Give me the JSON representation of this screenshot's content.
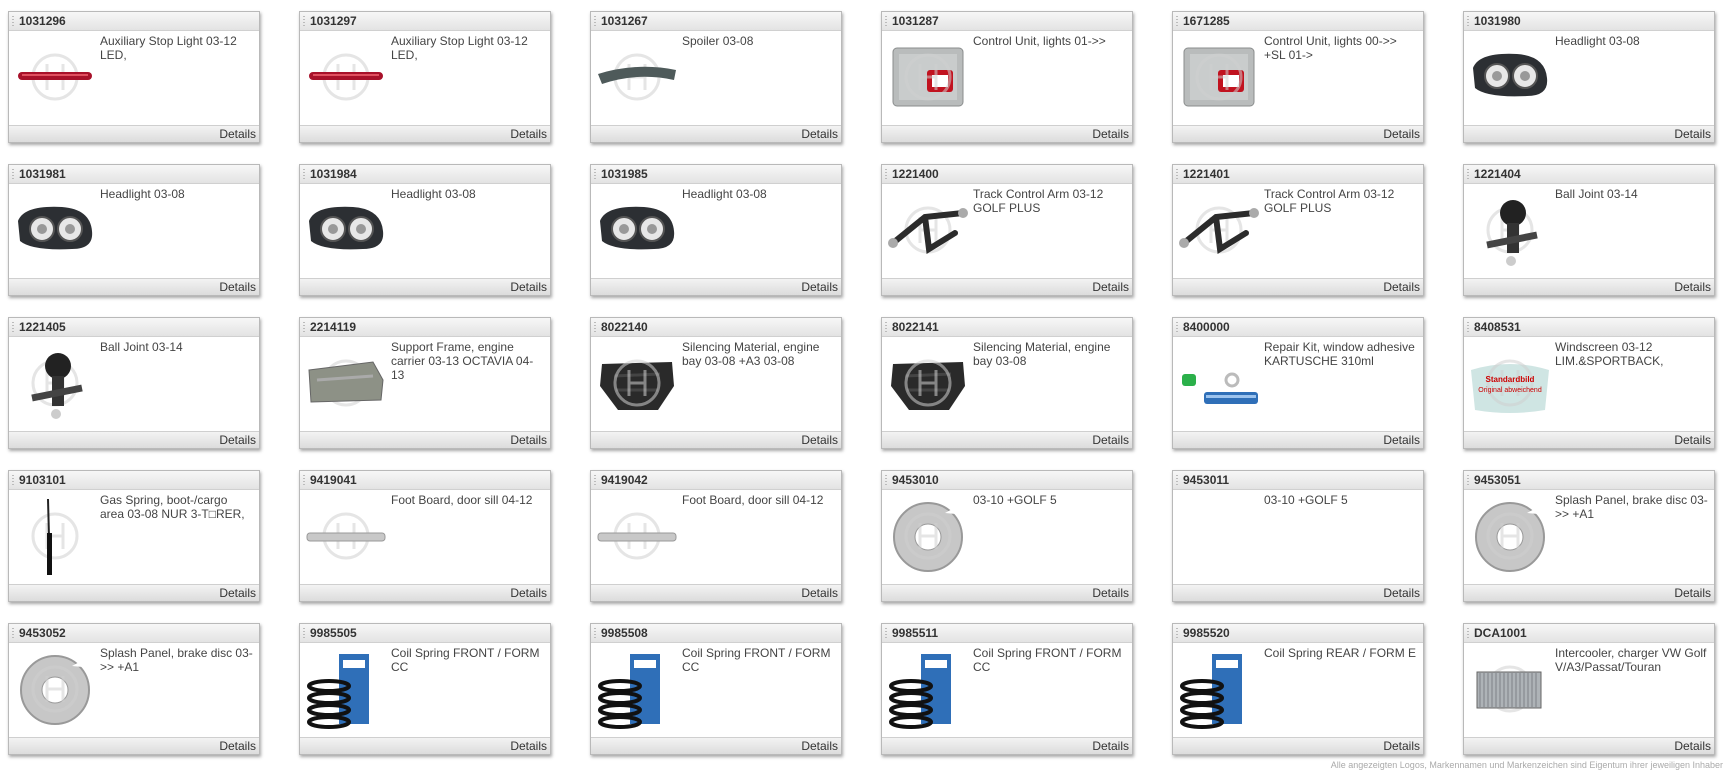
{
  "details_label": "Details",
  "footer_note": "Alle angezeigten Logos, Markennamen und Markenzeichen sind Eigentum ihrer jeweiligen Inhaber",
  "colors": {
    "card_border": "#b9b9b9",
    "header_bg": "#e9e9e9",
    "text": "#444444",
    "watermark": "#d5d5d5",
    "placeholder_red": "#cc0000"
  },
  "products": [
    {
      "id": "1031296",
      "desc": "Auxiliary Stop Light 03-12 LED,",
      "icon": "stop-light-icon"
    },
    {
      "id": "1031297",
      "desc": "Auxiliary Stop Light 03-12 LED,",
      "icon": "stop-light-icon"
    },
    {
      "id": "1031267",
      "desc": "Spoiler 03-08",
      "icon": "spoiler-icon"
    },
    {
      "id": "1031287",
      "desc": "Control Unit, lights 01->>",
      "icon": "control-unit-icon"
    },
    {
      "id": "1671285",
      "desc": "Control Unit, lights 00->> +SL 01->",
      "icon": "control-unit-icon"
    },
    {
      "id": "1031980",
      "desc": "Headlight 03-08",
      "icon": "headlight-icon"
    },
    {
      "id": "1031981",
      "desc": "Headlight 03-08",
      "icon": "headlight-icon"
    },
    {
      "id": "1031984",
      "desc": "Headlight 03-08",
      "icon": "headlight-icon"
    },
    {
      "id": "1031985",
      "desc": "Headlight 03-08",
      "icon": "headlight-icon"
    },
    {
      "id": "1221400",
      "desc": "Track Control Arm 03-12 GOLF PLUS",
      "icon": "control-arm-icon"
    },
    {
      "id": "1221401",
      "desc": "Track Control Arm 03-12 GOLF PLUS",
      "icon": "control-arm-icon"
    },
    {
      "id": "1221404",
      "desc": "Ball Joint 03-14",
      "icon": "ball-joint-icon"
    },
    {
      "id": "1221405",
      "desc": "Ball Joint 03-14",
      "icon": "ball-joint-icon"
    },
    {
      "id": "2214119",
      "desc": "Support Frame, engine carrier 03-13 OCTAVIA 04-13",
      "icon": "support-frame-icon"
    },
    {
      "id": "8022140",
      "desc": "Silencing Material, engine bay 03-08 +A3 03-08",
      "icon": "engine-cover-icon"
    },
    {
      "id": "8022141",
      "desc": "Silencing Material, engine bay 03-08",
      "icon": "engine-cover-icon"
    },
    {
      "id": "8400000",
      "desc": "Repair Kit, window adhesive KARTUSCHE 310ml",
      "icon": "adhesive-kit-icon"
    },
    {
      "id": "8408531",
      "desc": "Windscreen 03-12 LIM.&SPORTBACK,",
      "icon": "windscreen-placeholder-icon",
      "img_text1": "Standardbild",
      "img_text2": "Original abweichend"
    },
    {
      "id": "9103101",
      "desc": "Gas Spring, boot-/cargo area 03-08 NUR 3-T□RER,",
      "icon": "gas-spring-icon"
    },
    {
      "id": "9419041",
      "desc": "Foot Board, door sill 04-12",
      "icon": "door-sill-icon"
    },
    {
      "id": "9419042",
      "desc": "Foot Board, door sill 04-12",
      "icon": "door-sill-icon"
    },
    {
      "id": "9453010",
      "desc": "03-10 +GOLF 5",
      "icon": "splash-panel-icon"
    },
    {
      "id": "9453011",
      "desc": "03-10 +GOLF 5",
      "icon": "none"
    },
    {
      "id": "9453051",
      "desc": "Splash Panel, brake disc 03->> +A1",
      "icon": "splash-panel-icon"
    },
    {
      "id": "9453052",
      "desc": "Splash Panel, brake disc 03->> +A1",
      "icon": "splash-panel-icon"
    },
    {
      "id": "9985505",
      "desc": "Coil Spring FRONT / FORM CC",
      "icon": "coil-spring-icon"
    },
    {
      "id": "9985508",
      "desc": "Coil Spring FRONT / FORM CC",
      "icon": "coil-spring-icon"
    },
    {
      "id": "9985511",
      "desc": "Coil Spring FRONT / FORM CC",
      "icon": "coil-spring-icon"
    },
    {
      "id": "9985520",
      "desc": "Coil Spring REAR / FORM E",
      "icon": "coil-spring-icon"
    },
    {
      "id": "DCA1001",
      "desc": "Intercooler, charger VW Golf V/A3/Passat/Touran",
      "icon": "intercooler-icon"
    }
  ]
}
